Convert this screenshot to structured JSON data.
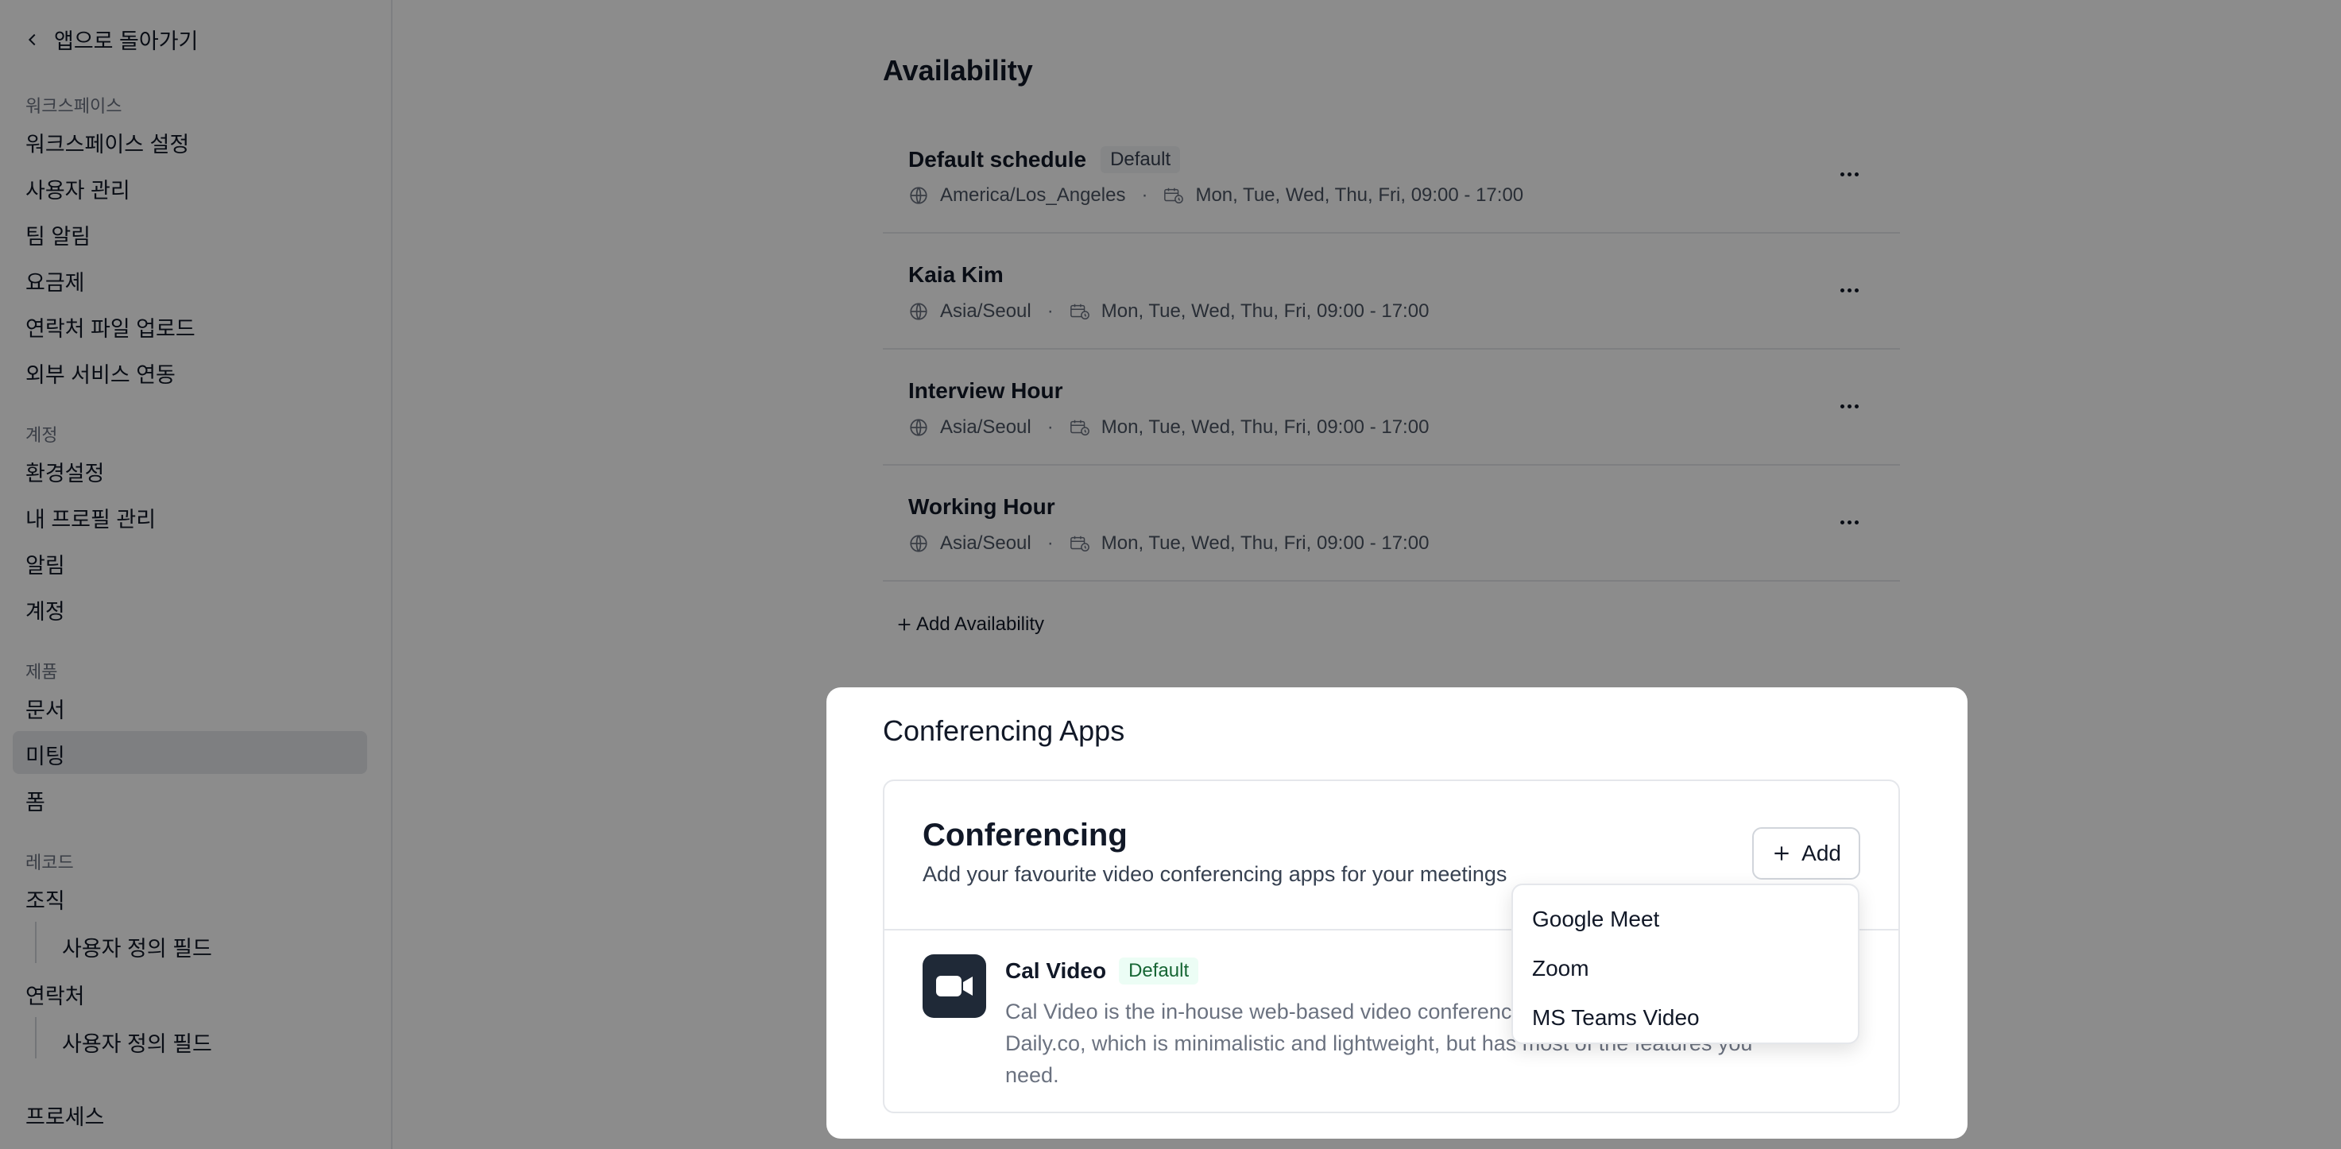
{
  "sidebar": {
    "back_label": "앱으로 돌아가기",
    "workspace_label": "워크스페이스",
    "workspace_items": [
      "워크스페이스 설정",
      "사용자 관리",
      "팀 알림",
      "요금제",
      "연락처 파일 업로드",
      "외부 서비스 연동"
    ],
    "account_label": "계정",
    "account_items": [
      "환경설정",
      "내 프로필 관리",
      "알림",
      "계정"
    ],
    "product_label": "제품",
    "product_items": [
      "문서",
      "미팅",
      "폼"
    ],
    "active_item": "미팅",
    "record_label": "레코드",
    "record_org": "조직",
    "record_org_sub": "사용자 정의 필드",
    "record_contact": "연락처",
    "record_contact_sub": "사용자 정의 필드",
    "process": "프로세스"
  },
  "availability": {
    "title": "Availability",
    "schedules": [
      {
        "name": "Default schedule",
        "badge": "Default",
        "timezone": "America/Los_Angeles",
        "hours": "Mon, Tue, Wed, Thu, Fri, 09:00 - 17:00"
      },
      {
        "name": "Kaia Kim",
        "timezone": "Asia/Seoul",
        "hours": "Mon, Tue, Wed, Thu, Fri, 09:00 - 17:00"
      },
      {
        "name": "Interview Hour",
        "timezone": "Asia/Seoul",
        "hours": "Mon, Tue, Wed, Thu, Fri, 09:00 - 17:00"
      },
      {
        "name": "Working Hour",
        "timezone": "Asia/Seoul",
        "hours": "Mon, Tue, Wed, Thu, Fri, 09:00 - 17:00"
      }
    ],
    "separator": "·",
    "add_label": "Add Availability"
  },
  "conferencing": {
    "section_title": "Conferencing Apps",
    "card_title": "Conferencing",
    "card_desc": "Add your favourite video conferencing apps for your meetings",
    "add_label": "Add",
    "app": {
      "name": "Cal Video",
      "badge": "Default",
      "desc": "Cal Video is the in-house web-based video conferencing platform powered by Daily.co, which is minimalistic and lightweight, but has most of the features you need."
    },
    "dropdown_options": [
      "Google Meet",
      "Zoom",
      "MS Teams Video"
    ]
  },
  "icons": {
    "back": "chevron-left-icon",
    "globe": "globe-icon",
    "calendar_clock": "calendar-clock-icon",
    "more": "more-horizontal-icon",
    "plus": "plus-icon",
    "video": "video-camera-icon"
  },
  "colors": {
    "overlay": "#000000",
    "active_nav": "#e5e7eb",
    "badge_green_bg": "#ecfdf5",
    "badge_green_text": "#166534",
    "app_icon_bg": "#1f2937"
  }
}
